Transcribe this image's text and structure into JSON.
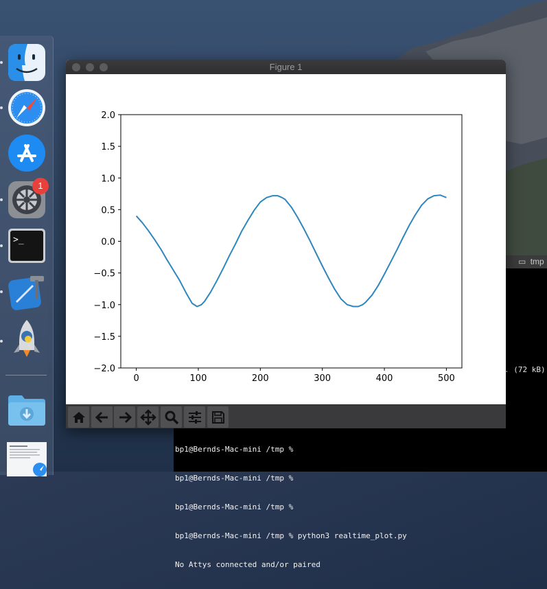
{
  "window": {
    "title": "Figure 1"
  },
  "dock": {
    "items": [
      {
        "icon": "finder-icon",
        "running": true
      },
      {
        "icon": "safari-icon",
        "running": true
      },
      {
        "icon": "app-store-icon",
        "running": false
      },
      {
        "icon": "system-preferences-icon",
        "running": true,
        "badge": "1"
      },
      {
        "icon": "terminal-icon",
        "running": true
      },
      {
        "icon": "xcode-icon",
        "running": true
      },
      {
        "icon": "python-launcher-icon",
        "running": true
      },
      {
        "icon": "downloads-folder-icon",
        "running": false
      },
      {
        "icon": "document-preview-icon",
        "running": false
      }
    ]
  },
  "toolbar": {
    "buttons": [
      "home-icon",
      "back-icon",
      "forward-icon",
      "pan-icon",
      "zoom-icon",
      "configure-subplots-icon",
      "save-icon"
    ]
  },
  "terminal": {
    "tab_label": "tmp",
    "size_text": ". (72 kB)",
    "lines": [
      "bp1@Bernds-Mac-mini /tmp %",
      "bp1@Bernds-Mac-mini /tmp %",
      "bp1@Bernds-Mac-mini /tmp %",
      "bp1@Bernds-Mac-mini /tmp % python3 realtime_plot.py",
      "No Attys connected and/or paired"
    ]
  },
  "colors": {
    "line": "#2d86bd",
    "toolbar": "#3a3a3c",
    "badge": "#e8413c"
  },
  "chart_data": {
    "type": "line",
    "title": "",
    "xlabel": "",
    "ylabel": "",
    "xlim": [
      -25,
      525
    ],
    "ylim": [
      -2.0,
      2.0
    ],
    "xticks": [
      0,
      100,
      200,
      300,
      400,
      500
    ],
    "yticks": [
      -2.0,
      -1.5,
      -1.0,
      -0.5,
      0.0,
      0.5,
      1.0,
      1.5,
      2.0
    ],
    "xtick_labels": [
      "0",
      "100",
      "200",
      "300",
      "400",
      "500"
    ],
    "ytick_labels": [
      "−2.0",
      "−1.5",
      "−1.0",
      "−0.5",
      "0.0",
      "0.5",
      "1.0",
      "1.5",
      "2.0"
    ],
    "grid": false,
    "series": [
      {
        "color": "#2d86bd",
        "x": [
          0,
          10,
          20,
          30,
          40,
          50,
          60,
          70,
          80,
          90,
          98,
          105,
          110,
          120,
          130,
          140,
          150,
          160,
          170,
          180,
          190,
          200,
          210,
          220,
          228,
          235,
          240,
          250,
          260,
          270,
          280,
          290,
          300,
          310,
          320,
          330,
          340,
          350,
          358,
          365,
          370,
          380,
          390,
          400,
          410,
          420,
          430,
          440,
          450,
          460,
          470,
          480,
          490,
          495,
          500
        ],
        "y": [
          0.4,
          0.29,
          0.16,
          0.02,
          -0.13,
          -0.3,
          -0.46,
          -0.62,
          -0.81,
          -0.98,
          -1.03,
          -1.0,
          -0.95,
          -0.8,
          -0.62,
          -0.43,
          -0.23,
          -0.04,
          0.16,
          0.33,
          0.49,
          0.62,
          0.69,
          0.72,
          0.72,
          0.69,
          0.66,
          0.54,
          0.38,
          0.2,
          0.01,
          -0.19,
          -0.39,
          -0.58,
          -0.76,
          -0.91,
          -1.0,
          -1.03,
          -1.03,
          -1.0,
          -0.96,
          -0.85,
          -0.7,
          -0.52,
          -0.33,
          -0.14,
          0.06,
          0.25,
          0.42,
          0.57,
          0.67,
          0.72,
          0.73,
          0.71,
          0.69
        ]
      }
    ]
  }
}
